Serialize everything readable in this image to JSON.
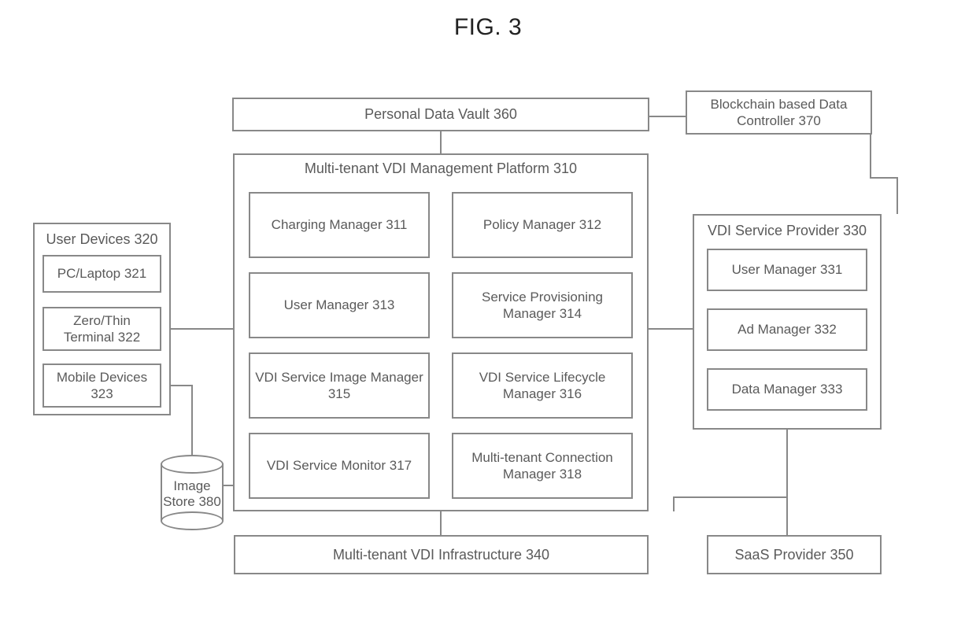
{
  "figure_title": "FIG. 3",
  "vault": {
    "label": "Personal Data Vault 360"
  },
  "blockchain": {
    "label": "Blockchain based Data Controller 370"
  },
  "platform": {
    "title": "Multi-tenant VDI Management Platform 310",
    "components": {
      "charging": "Charging Manager 311",
      "policy": "Policy Manager 312",
      "user": "User Manager 313",
      "provision": "Service Provisioning Manager 314",
      "image_mgr": "VDI Service Image Manager 315",
      "lifecycle": "VDI Service Lifecycle Manager 316",
      "monitor": "VDI Service Monitor 317",
      "conn": "Multi-tenant Connection Manager 318"
    }
  },
  "user_devices": {
    "title": "User Devices 320",
    "items": {
      "pc": "PC/Laptop 321",
      "thin": "Zero/Thin Terminal 322",
      "mobile": "Mobile Devices 323"
    }
  },
  "provider": {
    "title": "VDI Service Provider 330",
    "items": {
      "user": "User Manager 331",
      "ad": "Ad Manager 332",
      "data": "Data Manager 333"
    }
  },
  "image_store": {
    "label": "Image Store 380"
  },
  "infra": {
    "label": "Multi-tenant VDI Infrastructure 340"
  },
  "saas": {
    "label": "SaaS Provider 350"
  }
}
